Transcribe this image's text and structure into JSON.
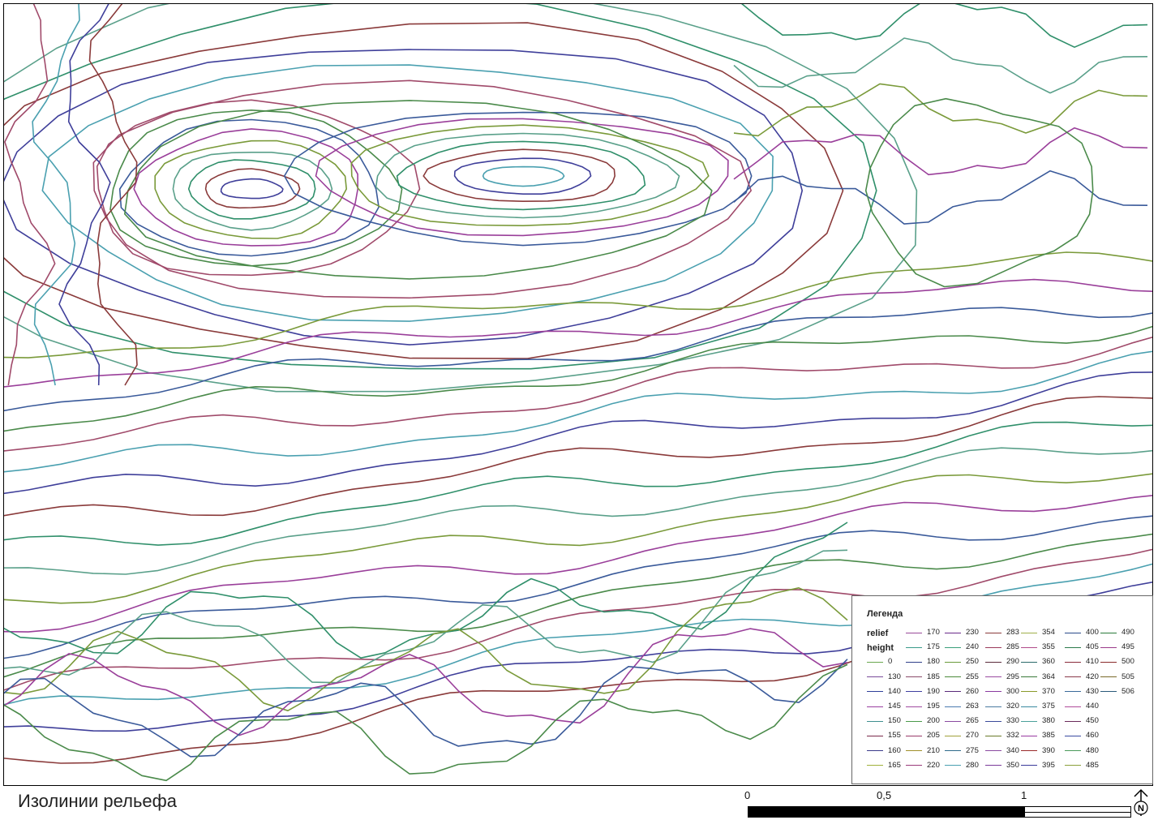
{
  "map": {
    "title": "Изолинии рельефа",
    "contour_palette": [
      "#3f3f9a",
      "#8a3a3a",
      "#2f8f6a",
      "#5aa08a",
      "#7a9a3a",
      "#9a3f9a",
      "#3a5a9a",
      "#4a8a4a",
      "#a04a6a",
      "#4aa0b0"
    ]
  },
  "legend": {
    "title": "Легенда",
    "layer_name": "relief",
    "field_name": "height",
    "items": [
      {
        "label": "0",
        "color": "#6aa84f"
      },
      {
        "label": "130",
        "color": "#7a4a9a"
      },
      {
        "label": "140",
        "color": "#2f3f9a"
      },
      {
        "label": "145",
        "color": "#9a3fa0"
      },
      {
        "label": "150",
        "color": "#3f8f8f"
      },
      {
        "label": "155",
        "color": "#7a2a4a"
      },
      {
        "label": "160",
        "color": "#3a3a8a"
      },
      {
        "label": "165",
        "color": "#a0b03a"
      },
      {
        "label": "170",
        "color": "#9a4a9a"
      },
      {
        "label": "175",
        "color": "#3a9a8a"
      },
      {
        "label": "180",
        "color": "#2f3f8a"
      },
      {
        "label": "185",
        "color": "#8a4a6a"
      },
      {
        "label": "190",
        "color": "#3f3fa0"
      },
      {
        "label": "195",
        "color": "#a04aa0"
      },
      {
        "label": "200",
        "color": "#4a9a4a"
      },
      {
        "label": "205",
        "color": "#9a3a6a"
      },
      {
        "label": "210",
        "color": "#a0902a"
      },
      {
        "label": "220",
        "color": "#9a3a7a"
      },
      {
        "label": "230",
        "color": "#6a2a8a"
      },
      {
        "label": "240",
        "color": "#3aa07a"
      },
      {
        "label": "250",
        "color": "#6a9a3a"
      },
      {
        "label": "255",
        "color": "#4a8a3a"
      },
      {
        "label": "260",
        "color": "#5a2a7a"
      },
      {
        "label": "263",
        "color": "#4a7ab0"
      },
      {
        "label": "265",
        "color": "#8a4aa0"
      },
      {
        "label": "270",
        "color": "#a0a03a"
      },
      {
        "label": "275",
        "color": "#2f6a8a"
      },
      {
        "label": "280",
        "color": "#4aa0b0"
      },
      {
        "label": "283",
        "color": "#8a3a3a"
      },
      {
        "label": "285",
        "color": "#9a3a5a"
      },
      {
        "label": "290",
        "color": "#5a2a3a"
      },
      {
        "label": "295",
        "color": "#9a4aa0"
      },
      {
        "label": "300",
        "color": "#8a3aa0"
      },
      {
        "label": "320",
        "color": "#4a7aa0"
      },
      {
        "label": "330",
        "color": "#3a4a9a"
      },
      {
        "label": "332",
        "color": "#6a7a2a"
      },
      {
        "label": "340",
        "color": "#8a4aa0"
      },
      {
        "label": "350",
        "color": "#7a3a9a"
      },
      {
        "label": "354",
        "color": "#a0b04a"
      },
      {
        "label": "355",
        "color": "#b04a8a"
      },
      {
        "label": "360",
        "color": "#2a6a6a"
      },
      {
        "label": "364",
        "color": "#3a7a3a"
      },
      {
        "label": "370",
        "color": "#8a9a2a"
      },
      {
        "label": "375",
        "color": "#3a8aa0"
      },
      {
        "label": "380",
        "color": "#4aa09a"
      },
      {
        "label": "385",
        "color": "#9a3aa0"
      },
      {
        "label": "390",
        "color": "#9a2a2a"
      },
      {
        "label": "395",
        "color": "#3a3a9a"
      },
      {
        "label": "400",
        "color": "#2a4a8a"
      },
      {
        "label": "405",
        "color": "#2a7a4a"
      },
      {
        "label": "410",
        "color": "#8a2a3a"
      },
      {
        "label": "420",
        "color": "#8a3a4a"
      },
      {
        "label": "430",
        "color": "#3a6a9a"
      },
      {
        "label": "440",
        "color": "#b04a9a"
      },
      {
        "label": "450",
        "color": "#6a2a5a"
      },
      {
        "label": "460",
        "color": "#3a4aa0"
      },
      {
        "label": "480",
        "color": "#4a9a5a"
      },
      {
        "label": "485",
        "color": "#8aa03a"
      },
      {
        "label": "490",
        "color": "#2a7a3a"
      },
      {
        "label": "495",
        "color": "#9a3a8a"
      },
      {
        "label": "500",
        "color": "#8a2a2a"
      },
      {
        "label": "505",
        "color": "#7a6a2a"
      },
      {
        "label": "506",
        "color": "#2a5a7a"
      }
    ]
  },
  "scale": {
    "labels": [
      "0",
      "0,5",
      "1"
    ]
  },
  "north_arrow": {
    "letter": "N"
  }
}
